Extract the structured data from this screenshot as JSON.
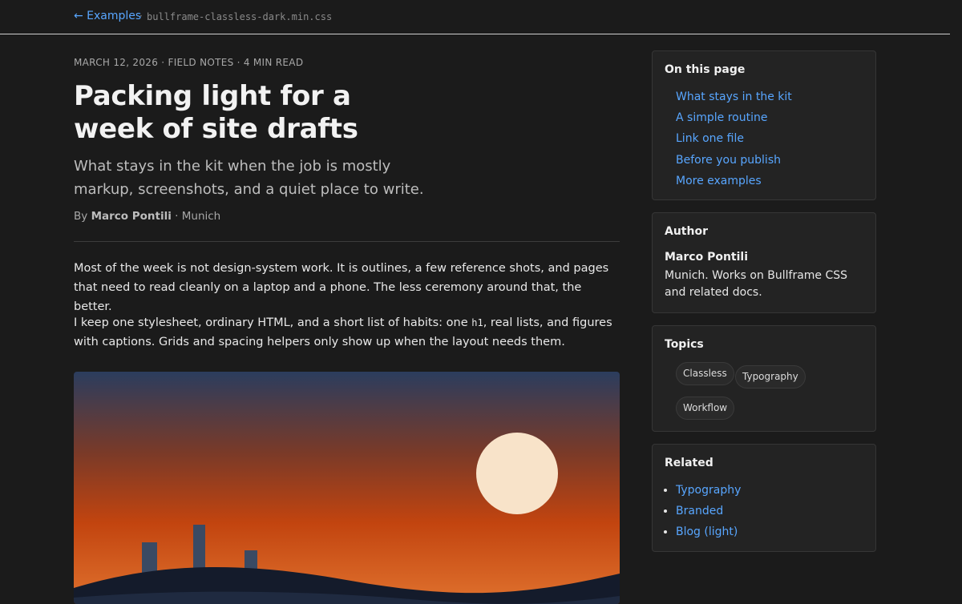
{
  "topbar": {
    "back_label": "← Examples",
    "separator": "·",
    "filename": "bullframe-classless-dark.min.css"
  },
  "article": {
    "meta": "MARCH 12, 2026 · FIELD NOTES · 4 MIN READ",
    "title": "Packing light for a week of site drafts",
    "subtitle": "What stays in the kit when the job is mostly markup, screenshots, and a quiet place to write.",
    "byline_prefix": "By",
    "author": "Marco Pontili",
    "byline_suffix": "· Munich",
    "paragraph1": "Most of the week is not design-system work. It is outlines, a few reference shots, and pages that need to read cleanly on a laptop and a phone. The less ceremony around that, the better.",
    "paragraph2_before": "I keep one stylesheet, ordinary HTML, and a short list of habits: one ",
    "paragraph2_code": "h1",
    "paragraph2_after": ", real lists, and figures with captions. Grids and spacing helpers only show up when the layout needs them."
  },
  "sidebar": {
    "toc": {
      "heading": "On this page",
      "items": [
        "What stays in the kit",
        "A simple routine",
        "Link one file",
        "Before you publish",
        "More examples"
      ]
    },
    "author": {
      "heading": "Author",
      "name": "Marco Pontili",
      "bio": "Munich. Works on Bullframe CSS and related docs."
    },
    "topics": {
      "heading": "Topics",
      "tags": [
        "Classless",
        "Typography",
        "Workflow"
      ]
    },
    "related": {
      "heading": "Related",
      "items": [
        "Typography",
        "Branded",
        "Blog (light)"
      ]
    }
  },
  "colors": {
    "background": "#1b1b1b",
    "link": "#58a6ff",
    "card": "#232323",
    "sun": "#f8e3c9"
  }
}
